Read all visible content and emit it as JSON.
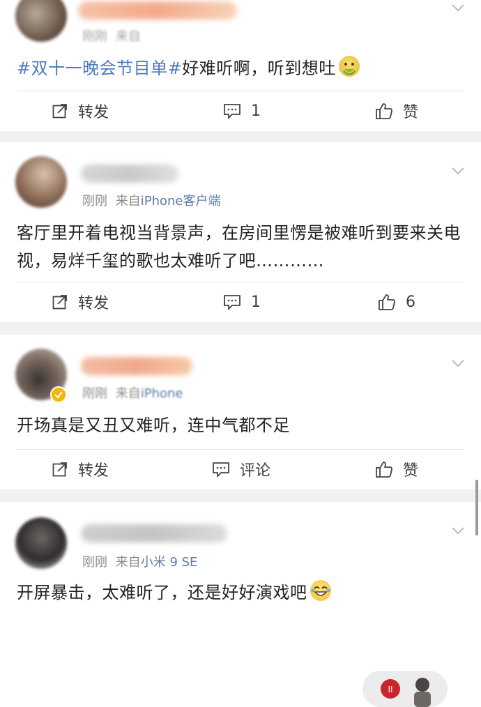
{
  "posts": [
    {
      "meta_time": "刚刚",
      "meta_from": "来自",
      "meta_source": "",
      "content_tag": "#双十一晚会节目单#",
      "content_text": "好难听啊，听到想吐",
      "emoji": "vomiting-face",
      "actions": {
        "repost": "转发",
        "comment": "1",
        "like": "赞"
      }
    },
    {
      "meta_time": "刚刚",
      "meta_from": "来自",
      "meta_source": "iPhone客户端",
      "content_text": "客厅里开着电视当背景声，在房间里愣是被难听到要来关电视，易烊千玺的歌也太难听了吧…………",
      "actions": {
        "repost": "转发",
        "comment": "1",
        "like": "6"
      }
    },
    {
      "meta_time": "刚刚",
      "meta_from": "来自",
      "meta_source": "iPhone",
      "content_text": "开场真是又丑又难听，连中气都不足",
      "actions": {
        "repost": "转发",
        "comment": "评论",
        "like": "赞"
      }
    },
    {
      "meta_time": "刚刚",
      "meta_from": "来自",
      "meta_source": "小米 9 SE",
      "content_text": "开屏暴击，太难听了，还是好好演戏吧",
      "emoji": "tears-of-joy-face"
    }
  ],
  "icons": {
    "repost": "repost-icon",
    "comment": "comment-icon",
    "like": "thumbs-up-icon",
    "more": "chevron-down-icon",
    "verified": "verified-badge-icon"
  },
  "colors": {
    "link": "#4d7bbd",
    "meta": "#8c8c8c",
    "source": "#5b7ca8",
    "separator": "#f1f1f1",
    "verified": "#f4b400"
  }
}
